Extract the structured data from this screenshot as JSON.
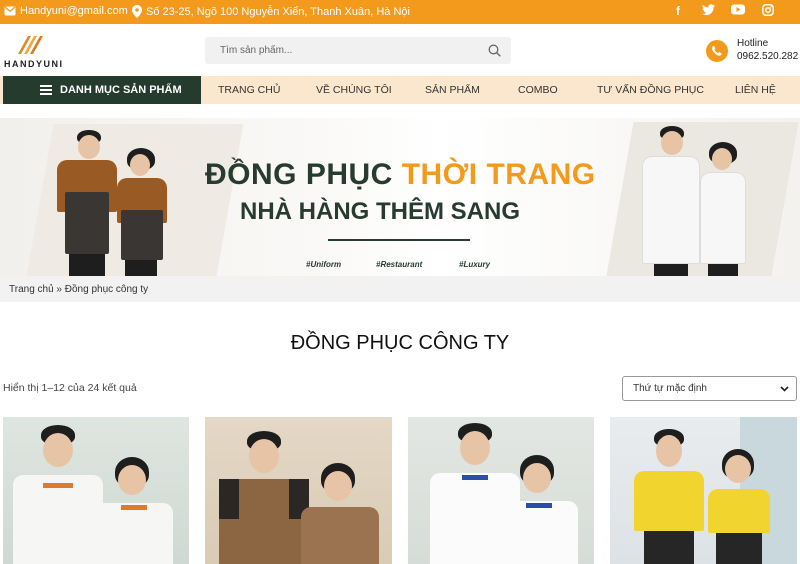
{
  "topbar": {
    "email": "Handyuni@gmail.com",
    "address": "Số 23-25, Ngõ 100 Nguyễn Xiển, Thanh Xuân, Hà Nội",
    "socials": [
      "facebook-icon",
      "twitter-icon",
      "youtube-icon",
      "instagram-icon"
    ],
    "color": "#f39a1d"
  },
  "header": {
    "logo_text": "HANDYUNI",
    "search_placeholder": "Tìm sản phẩm...",
    "hotline_label": "Hotline",
    "hotline_number": "0962.520.282"
  },
  "nav": {
    "category_button": "DANH MỤC SẢN PHẨM",
    "items": [
      "TRANG CHỦ",
      "VỀ CHÚNG TÔI",
      "SẢN PHẨM",
      "COMBO",
      "TƯ VẤN ĐỒNG PHỤC",
      "LIÊN HỆ"
    ]
  },
  "banner": {
    "line1_prefix": "ĐỒNG PHỤC ",
    "line1_highlight": "THỜI TRANG",
    "line2": "NHÀ HÀNG THÊM SANG",
    "tags": [
      "#Uniform",
      "#Restaurant",
      "#Luxury"
    ]
  },
  "breadcrumb": "Trang chủ » Đồng phục công ty",
  "page_title": "ĐỒNG PHỤC CÔNG TY",
  "results_count": "Hiển thị 1–12 của 24 kết quả",
  "sort": {
    "selected": "Thứ tự mặc định"
  },
  "colors": {
    "accent": "#f39a1d",
    "dark_green": "#243b2e",
    "nav_bg": "#fbe7cd"
  }
}
